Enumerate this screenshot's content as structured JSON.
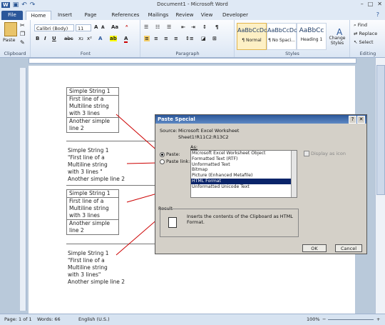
{
  "window": {
    "title": "Document1 - Microsoft Word"
  },
  "ribbon_tabs": [
    "File",
    "Home",
    "Insert",
    "Page Layout",
    "References",
    "Mailings",
    "Review",
    "View",
    "Developer"
  ],
  "ribbon": {
    "clipboard": {
      "paste_label": "Paste",
      "group": "Clipboard"
    },
    "font": {
      "font_name": "Calibri (Body)",
      "font_size": "11",
      "group": "Font"
    },
    "paragraph": {
      "group": "Paragraph"
    },
    "styles": {
      "items": [
        {
          "preview": "AaBbCcDc",
          "name": "¶ Normal"
        },
        {
          "preview": "AaBbCcDc",
          "name": "¶ No Spaci..."
        },
        {
          "preview": "AaBbCc",
          "name": "Heading 1"
        }
      ],
      "change_label": "Change Styles",
      "group": "Styles"
    },
    "editing": {
      "find": "Find",
      "replace": "Replace",
      "select": "Select",
      "group": "Editing"
    }
  },
  "document": {
    "block1": [
      "Simple String 1",
      "First line of a",
      "Multiline string",
      "with 3 lines",
      "Another simple",
      "line 2"
    ],
    "block2": [
      "Simple String 1",
      "\"First line of a",
      "Multiline string",
      "with 3 lines \"",
      "Another simple line 2"
    ],
    "block3": [
      "Simple String 1",
      "First line of a",
      "Multiline string",
      "with 3 lines",
      "Another simple",
      "line 2"
    ],
    "block4": [
      "Simple String 1",
      "\"First line of a",
      "Multiline string",
      "with 3 lines\"",
      "Another simple line 2"
    ]
  },
  "dialog": {
    "title": "Paste Special",
    "source_label": "Source:",
    "source_value": "Microsoft Excel Worksheet",
    "source_range": "Sheet1!R11C2:R13C2",
    "as_label": "As:",
    "paste_label": "Paste:",
    "paste_link_label": "Paste link:",
    "display_icon_label": "Display as icon",
    "options": [
      "Microsoft Excel Worksheet Object",
      "Formatted Text (RTF)",
      "Unformatted Text",
      "Bitmap",
      "Picture (Enhanced Metafile)",
      "HTML Format",
      "Unformatted Unicode Text"
    ],
    "selected_option": "HTML Format",
    "result_label": "Result",
    "result_text": "Inserts the contents of the Clipboard as HTML Format.",
    "ok_label": "OK",
    "cancel_label": "Cancel"
  },
  "status": {
    "page": "Page: 1 of 1",
    "words": "Words: 66",
    "language": "English (U.S.)",
    "zoom": "100%"
  }
}
